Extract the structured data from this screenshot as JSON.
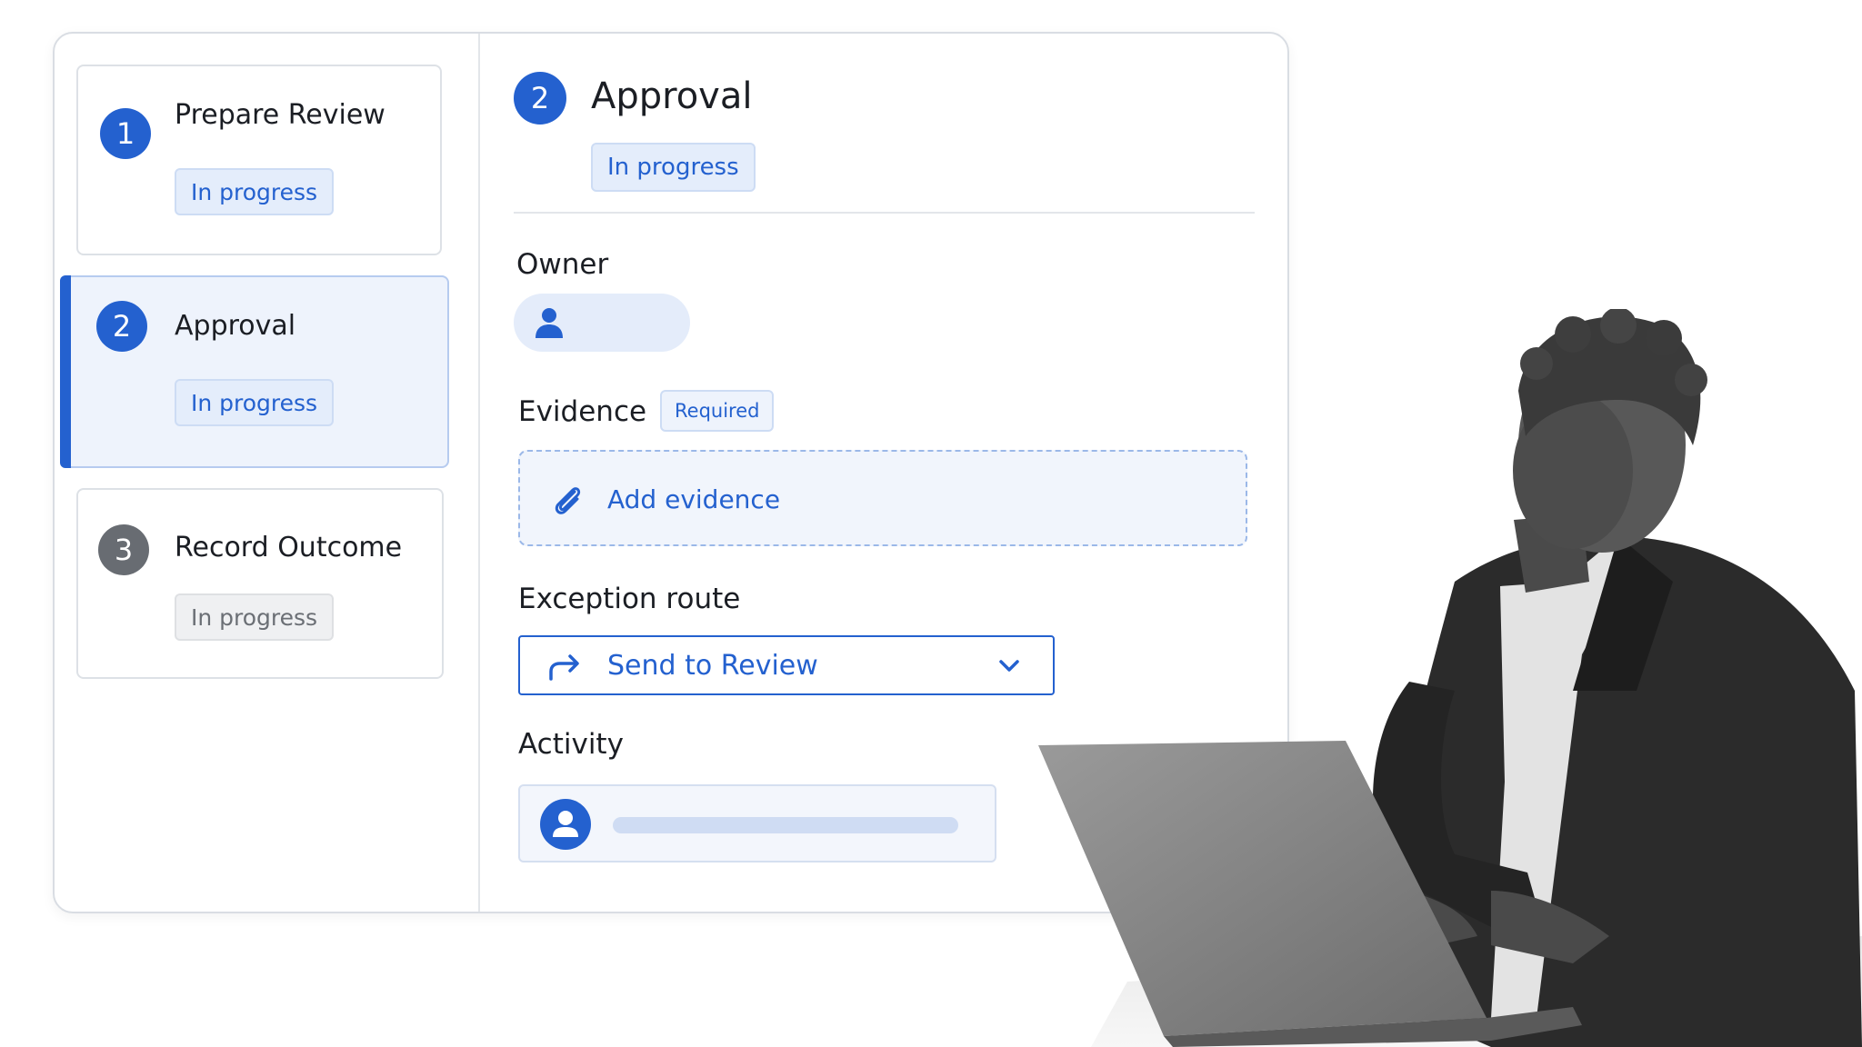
{
  "steps": [
    {
      "number": "1",
      "title": "Prepare Review",
      "status": "In progress",
      "state": "complete"
    },
    {
      "number": "2",
      "title": "Approval",
      "status": "In progress",
      "state": "active"
    },
    {
      "number": "3",
      "title": "Record Outcome",
      "status": "In progress",
      "state": "pending"
    }
  ],
  "detail": {
    "number": "2",
    "title": "Approval",
    "status": "In progress",
    "owner_label": "Owner",
    "evidence_label": "Evidence",
    "evidence_badge": "Required",
    "add_evidence": "Add evidence",
    "exception_label": "Exception route",
    "exception_value": "Send to Review",
    "activity_label": "Activity"
  },
  "icons": {
    "owner": "person-icon",
    "evidence": "paperclip-icon",
    "route": "forward-arrow-icon",
    "dropdown": "chevron-down-icon",
    "activity": "person-icon"
  },
  "colors": {
    "accent": "#2461cf",
    "accent_light": "#e4edfb",
    "pending_gray": "#686c72"
  }
}
